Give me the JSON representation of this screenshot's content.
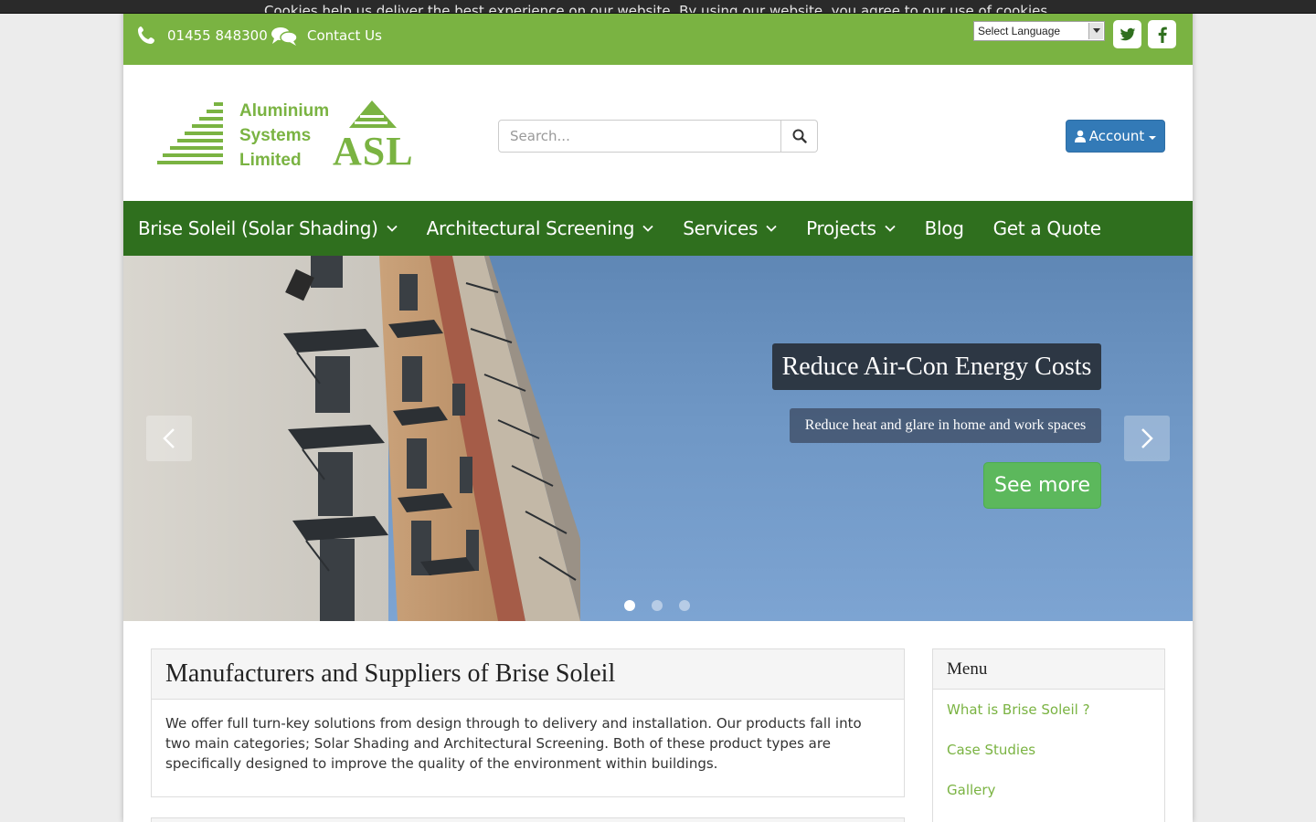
{
  "cookie_banner": {
    "text": "Cookies help us deliver the best experience on our website. By using our website, you agree to our use of cookies."
  },
  "topbar": {
    "phone": "01455 848300",
    "contact_label": "Contact Us",
    "language_select": "Select Language",
    "social": [
      {
        "name": "twitter",
        "icon": "twitter-icon"
      },
      {
        "name": "facebook",
        "icon": "facebook-icon"
      }
    ]
  },
  "logo": {
    "line1": "Aluminium",
    "line2": "Systems",
    "line3": "Limited",
    "mark": "ASL"
  },
  "search": {
    "placeholder": "Search..."
  },
  "account": {
    "label": "Account"
  },
  "nav": {
    "items": [
      {
        "label": "Brise Soleil (Solar Shading)",
        "dropdown": true
      },
      {
        "label": "Architectural Screening",
        "dropdown": true
      },
      {
        "label": "Services",
        "dropdown": true
      },
      {
        "label": "Projects",
        "dropdown": true
      },
      {
        "label": "Blog",
        "dropdown": false
      },
      {
        "label": "Get a Quote",
        "dropdown": false
      }
    ]
  },
  "hero": {
    "title": "Reduce Air-Con Energy Costs",
    "subtitle": "Reduce heat and glare in home and work spaces",
    "cta": "See more",
    "active_slide": 1,
    "slide_count": 3
  },
  "main": {
    "title": "Manufacturers and Suppliers of Brise Soleil",
    "body": "We offer full turn-key solutions from design through to delivery and installation. Our products fall into two main categories; Solar Shading and Architectural Screening. Both of these product types are specifically designed to improve the quality of the environment within buildings."
  },
  "sidebar": {
    "title": "Menu",
    "links": [
      "What is Brise Soleil ?",
      "Case Studies",
      "Gallery"
    ]
  },
  "colors": {
    "brand_green": "#7ab342",
    "nav_green": "#2f6f1e",
    "account_blue": "#337ab7",
    "cta_green": "#5cb85c"
  }
}
